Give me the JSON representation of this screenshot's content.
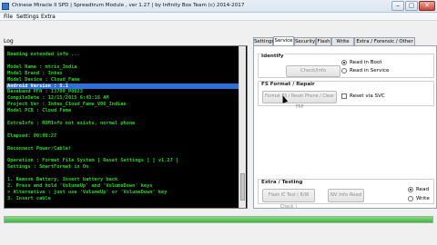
{
  "window": {
    "title": "Chinese Miracle II SPD | Spreadtrum Module , ver 1.27 | by Infinity Box Team (c) 2014-2017",
    "minimize_symbol": "‒",
    "maximize_symbol": "▢",
    "close_symbol": "✕"
  },
  "menu": {
    "file": "File",
    "settings": "Settings",
    "extra": "Extra"
  },
  "log_label": "Log",
  "console": {
    "lines": [
      "Reading extended info ...",
      "",
      "Model Name : mtrix_India",
      "Model Brand : Intex",
      "Model Device : Cloud_Fame",
      "Android Version : 5.1",
      "Baseband PFN : I3700_P0023",
      "CompileDate : 12/15/2015 6:43:16 AM",
      "Project Ver : Intex_Cloud_Fame_V06_Indian",
      "Model PCB : Cloud Fame",
      "",
      "ExtraInfo : ROMInfo not exists, normal phone",
      "",
      "Elapsed: 00:00:27",
      "",
      "Reconnect Power/Cable!",
      "",
      "Operation : Format File System [ Reset Settings ] [ v1.27 ]",
      "Settings : SmartFormat is On",
      "",
      "1. Remove Battery, Insert battery back",
      "2. Press and hold 'VolumeUp' and 'VolumeDown' keys",
      "  > Alternative : just use 'VolumeUp' or 'VolumeDown' key",
      "3. Insert cable",
      "",
      ">>> Wait for phone..."
    ],
    "highlighted_line": "Android Version : 5.1"
  },
  "tabs": [
    "Settings",
    "Service",
    "Security",
    "Flash",
    "Write Data",
    "Extra / Forensic / Other"
  ],
  "active_tab": "Service",
  "identify": {
    "label": "Identify",
    "check_info_button": "Check/Info",
    "read_in_boot": "Read in Boot",
    "read_in_service": "Read in Service"
  },
  "fs_format": {
    "label": "FS Format / Repair",
    "format_button": "Format FS / Reset Phone / Clear FRP",
    "reset_via_svc": "Reset via SVC"
  },
  "extra_testing": {
    "label": "Extra / Testing",
    "flash_ic_button": "Flash IC Test ( R/W Check )",
    "nv_info_button": "NV Info Read",
    "read": "Read",
    "write": "Write"
  },
  "progress": {
    "value_percent": 100
  },
  "colors": {
    "console_text": "#22d422",
    "console_bg": "#000000",
    "highlight": "#2f6fd6",
    "progress_fill": "#3fb53f"
  }
}
